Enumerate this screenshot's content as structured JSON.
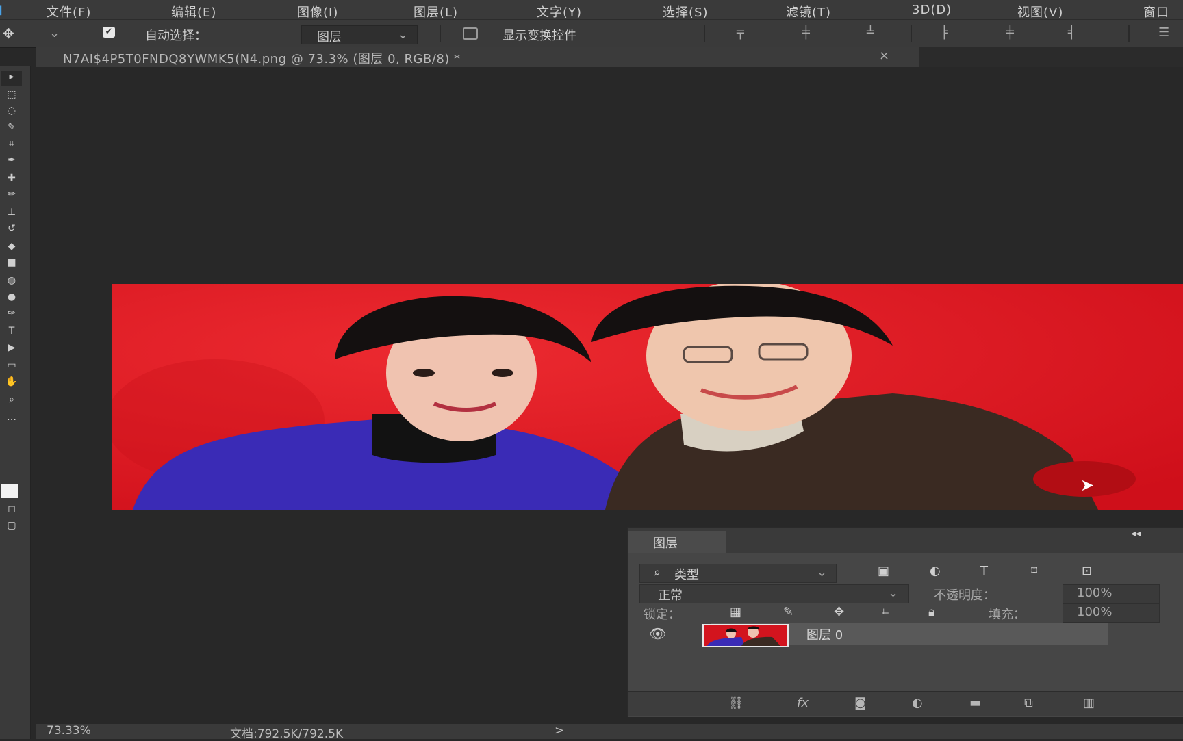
{
  "menubar": {
    "items": [
      "文件(F)",
      "编辑(E)",
      "图像(I)",
      "图层(L)",
      "文字(Y)",
      "选择(S)",
      "滤镜(T)",
      "3D(D)",
      "视图(V)",
      "窗口"
    ]
  },
  "options": {
    "auto_select_label": "自动选择：",
    "auto_select_value": "图层",
    "show_transform_label": "显示变换控件"
  },
  "document": {
    "tab_title": "N7AI$4P5T0FNDQ8YWMK5(N4.png @ 73.3% (图层 0, RGB/8) *",
    "close_glyph": "×"
  },
  "layers_panel": {
    "title": "图层",
    "filter_label": "类型",
    "blend_mode": "正常",
    "opacity_label": "不透明度：",
    "opacity_value": "100%",
    "lock_label": "锁定：",
    "fill_label": "填充：",
    "fill_value": "100%",
    "layer_name": "图层 0",
    "fx_label": "fx"
  },
  "status": {
    "zoom": "73.33%",
    "doc_size": "文档:792.5K/792.5K",
    "arrow": ">"
  },
  "colors": {
    "photo_background": "#d91420",
    "ui_dark": "#282828",
    "panel": "#464646"
  },
  "icons": [
    "move-tool-icon",
    "chevron-down-icon",
    "checkbox-checked-icon",
    "align-icons",
    "search-icon",
    "eye-icon",
    "link-icon",
    "mask-icon",
    "adjustment-icon",
    "folder-icon",
    "new-layer-icon",
    "trash-icon",
    "cursor-arrow-icon"
  ]
}
